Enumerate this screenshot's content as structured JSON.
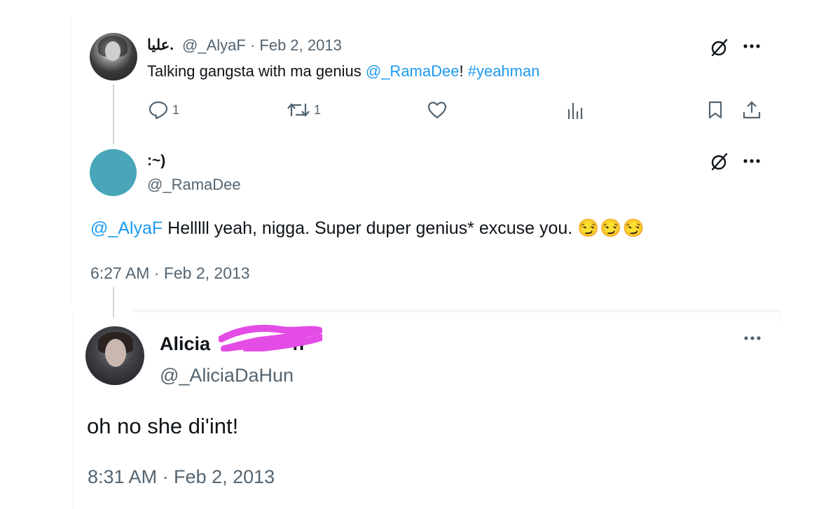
{
  "tweet1": {
    "display_name": "عليا.",
    "handle": "@_AlyaF",
    "separator": "·",
    "date": "Feb 2, 2013",
    "text_pre": "Talking gangsta with ma genius ",
    "mention": "@_RamaDee",
    "text_mid": "! ",
    "hashtag": "#yeahman",
    "actions": {
      "reply_count": "1",
      "retweet_count": "1"
    }
  },
  "tweet2": {
    "display_name": ":~)",
    "handle": "@_RamaDee",
    "mention": "@_AlyaF",
    "text": " Helllll yeah, nigga. Super duper genius* excuse you.",
    "emoji": "😏😏😏",
    "timestamp": "6:27 AM · Feb 2, 2013"
  },
  "tweet3": {
    "display_name": "Alicia",
    "display_name_tail": "n",
    "handle": "@_AliciaDaHun",
    "text": "oh no she di'int!",
    "timestamp": "8:31 AM · Feb 2, 2013"
  },
  "colors": {
    "link": "#1d9bf0",
    "meta": "#536471",
    "redaction": "#e44ce6",
    "avatar2": "#48a6b8"
  },
  "icons": [
    "grok-icon",
    "more-icon",
    "reply-icon",
    "retweet-icon",
    "like-icon",
    "views-icon",
    "bookmark-icon",
    "share-icon"
  ]
}
